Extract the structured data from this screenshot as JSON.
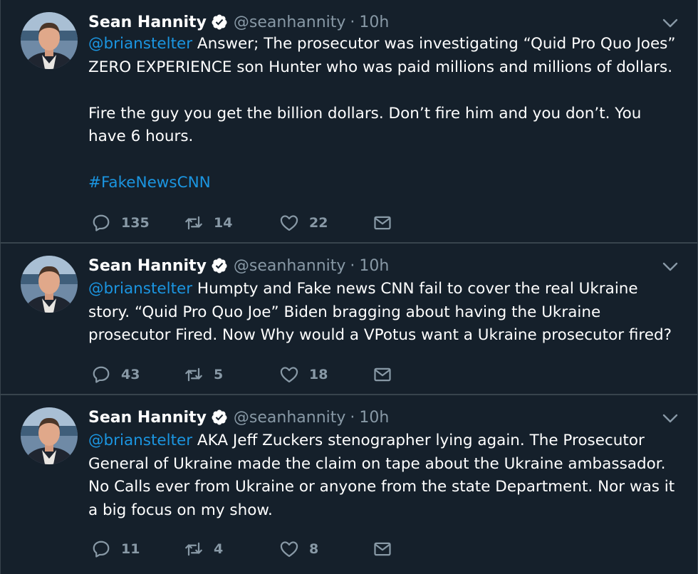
{
  "tweets": [
    {
      "name": "Sean Hannity",
      "handle": "@seanhannity",
      "separator": "·",
      "time": "10h",
      "mention": "@brianstelter",
      "text1": " Answer; The prosecutor was investigating “Quid Pro Quo Joes” ZERO EXPERIENCE son Hunter who was paid millions and millions of dollars.",
      "text2": "Fire the guy you get the billion dollars. Don’t fire him and you don’t. You have 6 hours.",
      "hashtag": "#FakeNewsCNN",
      "replies": "135",
      "retweets": "14",
      "likes": "22"
    },
    {
      "name": "Sean Hannity",
      "handle": "@seanhannity",
      "separator": "·",
      "time": "10h",
      "mention": "@brianstelter",
      "text1": " Humpty and Fake news CNN fail to cover the real Ukraine story. “Quid Pro Quo Joe” Biden bragging about having the Ukraine prosecutor Fired. Now Why would a VPotus want a Ukraine prosecutor fired?",
      "replies": "43",
      "retweets": "5",
      "likes": "18"
    },
    {
      "name": "Sean Hannity",
      "handle": "@seanhannity",
      "separator": "·",
      "time": "10h",
      "mention": "@brianstelter",
      "text1": " AKA Jeff Zuckers stenographer lying again. The Prosecutor General of Ukraine made the claim on tape about the Ukraine ambassador. No Calls ever from Ukraine or anyone from the state Department. Nor was it a big focus on my show.",
      "replies": "11",
      "retweets": "4",
      "likes": "8"
    }
  ],
  "icons": {
    "reply": "reply-icon",
    "retweet": "retweet-icon",
    "like": "heart-icon",
    "dm": "envelope-icon",
    "verified": "verified-badge-icon",
    "caret": "chevron-down-icon"
  },
  "colors": {
    "background": "#15202b",
    "link": "#1b95e0",
    "muted": "#8899a6",
    "divider": "#38444d"
  }
}
